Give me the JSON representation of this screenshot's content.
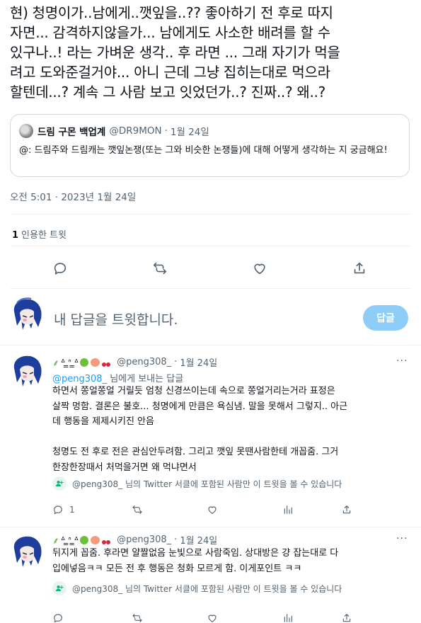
{
  "main_tweet": {
    "text": "현) 청명이가..남에게..깻잎을..?? 좋아하기 전 후로 따지\n자면... 감격하지않을가... 남에게도 사소한 배려를 할 수\n있구나..! 라는 가벼운 생각.. 후 라면 ... 그래 자기가 먹을\n려고 도와준걸거야... 아니 근데 그냥 집히는대로 먹으라\n할텐데...? 계속 그 사람 보고 잇었던가..? 진짜..? 왜..?",
    "quote": {
      "name": "드림 구몬 백업계",
      "handle": "@DR9MON",
      "dot": "·",
      "date": "1월 24일",
      "text": "@: 드림주와 드림캐는 깻잎논쟁(또는 그와 비슷한 논쟁들)에 대해 어떻게 생각하는 지 궁금해요!"
    },
    "timestamp": "오전 5:01 · 2023년 1월 24일",
    "quote_count": "1",
    "quote_count_label": "인용한 트윗"
  },
  "reply_box": {
    "placeholder": "내 답글을 트윗합니다.",
    "button_label": "답글"
  },
  "replies": [
    {
      "display_name": "ᐞ ̳ᐢ ̳ᐞ",
      "handle": "@peng308_",
      "dot": "·",
      "date": "1월 24일",
      "more": "···",
      "replying_to_handle": "@peng308_",
      "replying_to_suffix": "님에게 보내는 답글",
      "body": "하면서 쫑얼쫑얼 거릴듯 엄청 신경쓰이는데 속으로 쫑얼거리는거라 표정은\n살짝 멍함. 결론은 불호... 청명에게 만큼은 욕심냄. 말을 못해서 그렇지.. 아근\n데 행동을 제제시키진 안음\n\n청명도 전 후로 전은 관심안두려함. 그리고 깻잎 못땐사람한테 개꼽줌. 그거\n한장한장때서 처먹을거면 왜 먹냐면서",
      "notice": "@peng308_ 님의 Twitter 서클에 포함된 사람만 이 트윗을 볼 수 있습니다",
      "reply_count": "1"
    },
    {
      "display_name": "ᐞ ̳ᐢ ̳ᐞ",
      "handle": "@peng308_",
      "dot": "·",
      "date": "1월 24일",
      "more": "···",
      "body": "뒤지게 꼽줌. 후라면 얄짤없음 눈빛으로 사람죽임. 상대방은 걍 잡는대로 다\n입에넣음ㅋㅋ 모든 전 후 행동은 청화 모르게 함. 이게포인트 ㅋㅋ",
      "notice": "@peng308_ 님의 Twitter 서클에 포함된 사람만 이 트윗을 볼 수 있습니다"
    }
  ],
  "icons": {
    "reply": "reply-icon",
    "retweet": "retweet-icon",
    "like": "heart-icon",
    "views": "views-icon",
    "share": "share-icon",
    "circle": "circle-icon"
  },
  "colors": {
    "accent": "#1d9bf0",
    "reply_button_disabled": "#8ecdf7",
    "circle_green": "#00ba7c",
    "secondary_text": "#536471"
  }
}
